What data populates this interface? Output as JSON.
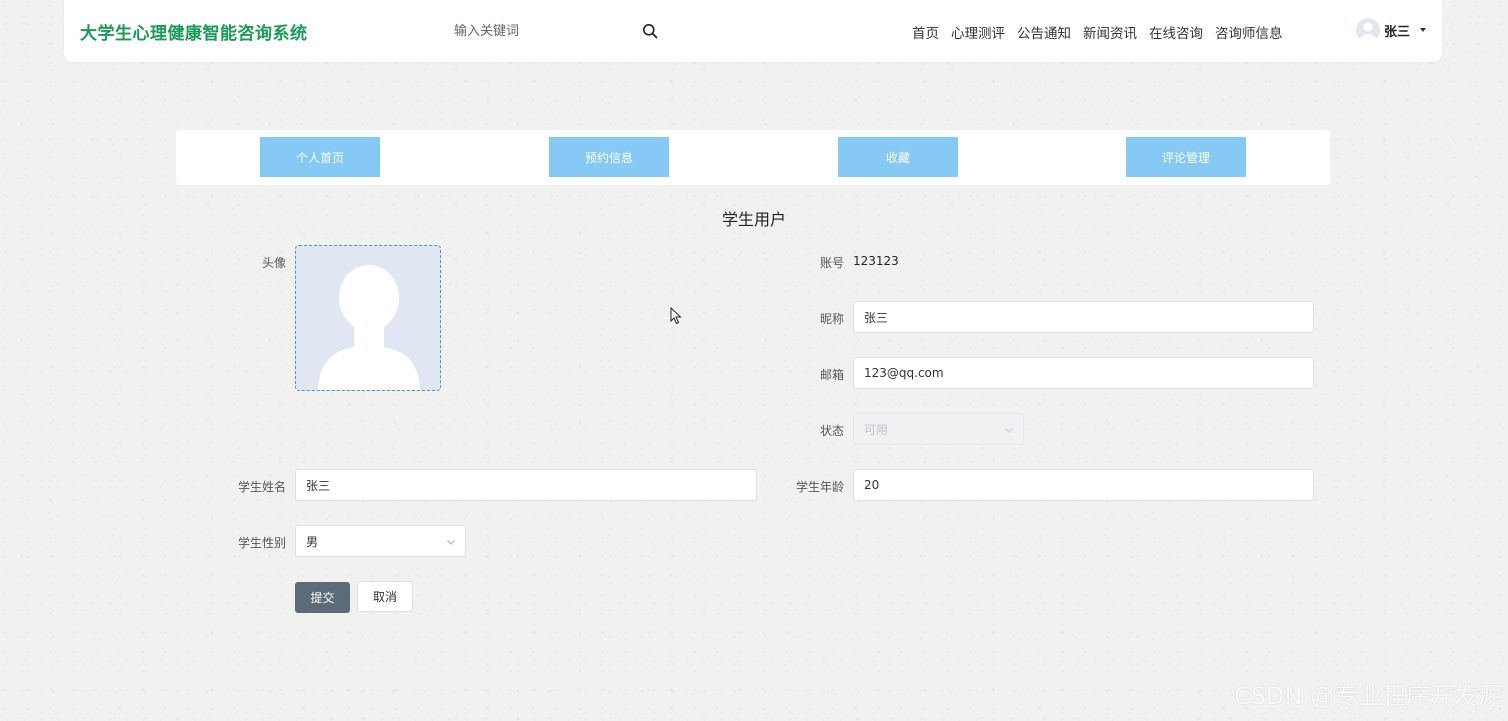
{
  "header": {
    "brand": "大学生心理健康智能咨询系统",
    "search_placeholder": "输入关键词",
    "nav": [
      "首页",
      "心理测评",
      "公告通知",
      "新闻资讯",
      "在线咨询",
      "咨询师信息"
    ],
    "user_name": "张三"
  },
  "tabs": [
    "个人首页",
    "预约信息",
    "收藏",
    "评论管理"
  ],
  "form": {
    "title": "学生用户",
    "avatar_label": "头像",
    "account_label": "账号",
    "account_value": "123123",
    "nickname_label": "昵称",
    "nickname_value": "张三",
    "email_label": "邮箱",
    "email_value": "123@qq.com",
    "status_label": "状态",
    "status_value": "可用",
    "name_label": "学生姓名",
    "name_value": "张三",
    "age_label": "学生年龄",
    "age_value": "20",
    "gender_label": "学生性别",
    "gender_value": "男",
    "submit_label": "提交",
    "cancel_label": "取消"
  },
  "watermark": "CSDN @专业程序开发源",
  "colors": {
    "brand": "#1a9a58",
    "tab_bg": "#86c9f4",
    "submit_bg": "#5c6b7a",
    "avatar_border": "#4a90d9"
  },
  "icons": {
    "search": "search-icon",
    "caret": "caret-down-icon",
    "chevron": "chevron-down-icon",
    "avatar": "avatar-placeholder-icon"
  }
}
